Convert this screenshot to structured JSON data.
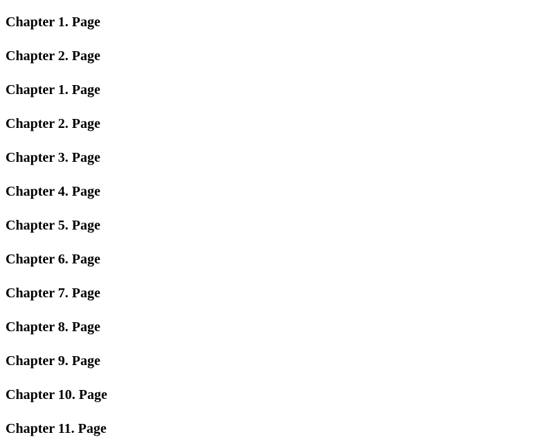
{
  "chapters": [
    {
      "label": "Chapter 1. Page"
    },
    {
      "label": "Chapter 2. Page"
    },
    {
      "label": "Chapter 1. Page"
    },
    {
      "label": "Chapter 2. Page"
    },
    {
      "label": "Chapter 3. Page"
    },
    {
      "label": "Chapter 4. Page"
    },
    {
      "label": "Chapter 5. Page"
    },
    {
      "label": "Chapter 6. Page"
    },
    {
      "label": "Chapter 7. Page"
    },
    {
      "label": "Chapter 8. Page"
    },
    {
      "label": "Chapter 9. Page"
    },
    {
      "label": "Chapter 10. Page"
    },
    {
      "label": "Chapter 11. Page"
    }
  ]
}
